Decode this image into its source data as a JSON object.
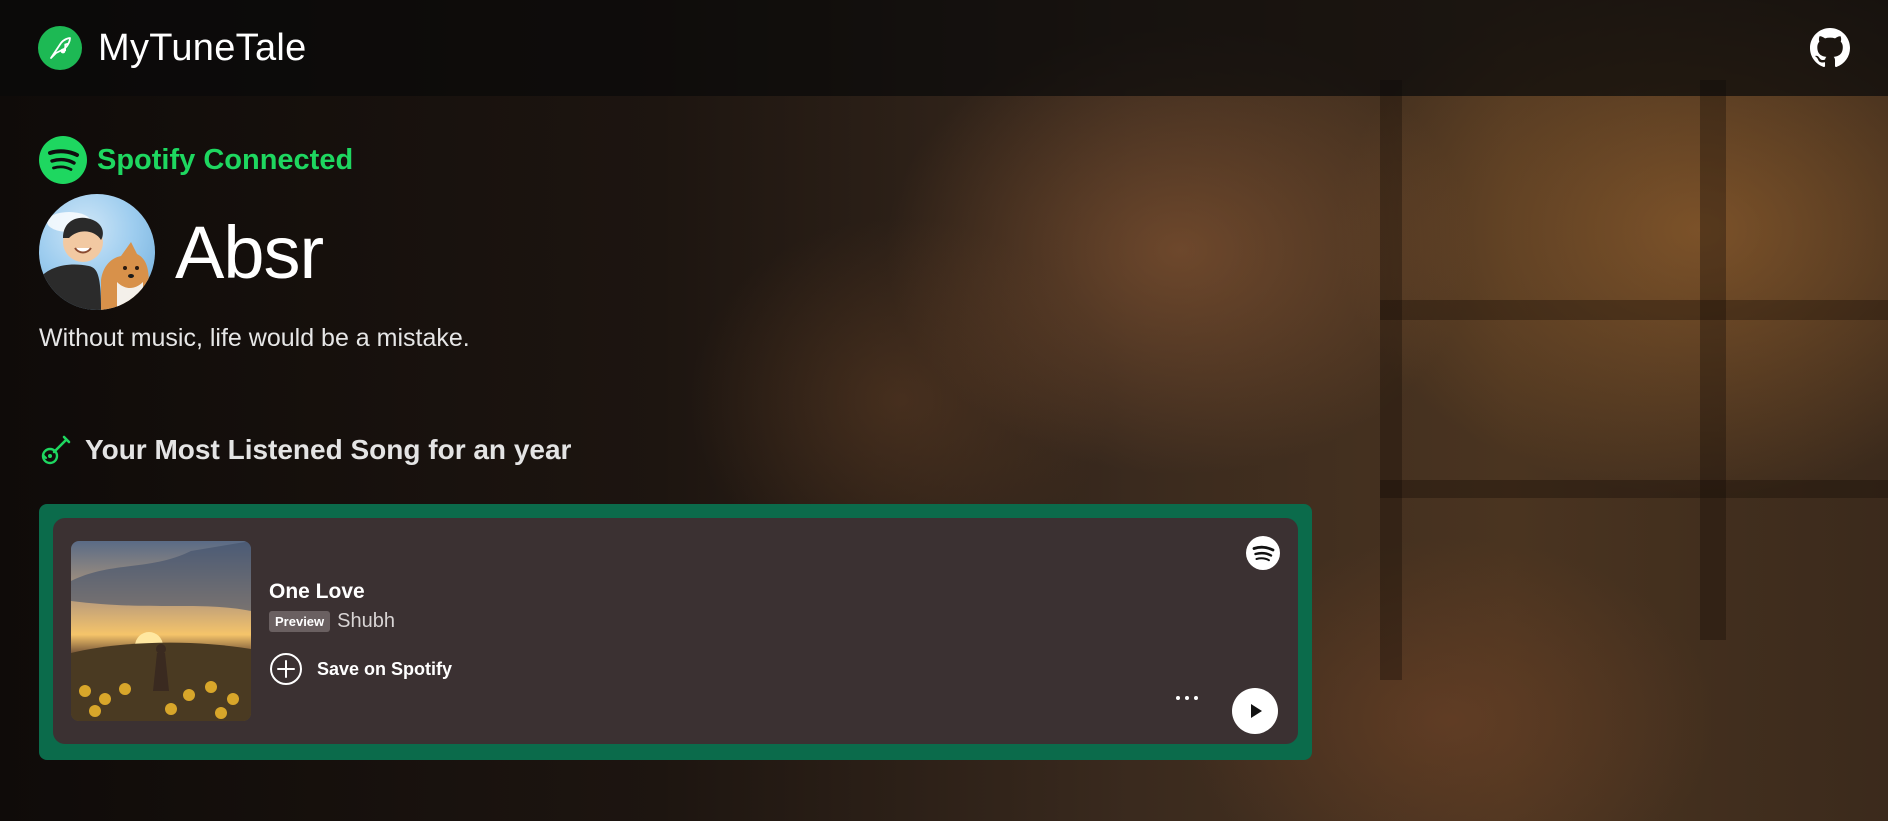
{
  "header": {
    "brand_name": "MyTuneTale",
    "logo_icon": "feather-music-icon",
    "github_icon": "github-icon"
  },
  "profile": {
    "spotify_status": "Spotify Connected",
    "username": "Absr",
    "tagline": "Without music, life would be a mistake."
  },
  "section": {
    "title": "Your Most Listened Song for an year",
    "icon": "guitar-icon"
  },
  "song": {
    "title": "One Love",
    "badge": "Preview",
    "artist": "Shubh",
    "save_label": "Save on Spotify"
  },
  "colors": {
    "spotify_green": "#1ed760",
    "card_outer": "#0b6b4b",
    "card_inner": "#3b3132"
  }
}
